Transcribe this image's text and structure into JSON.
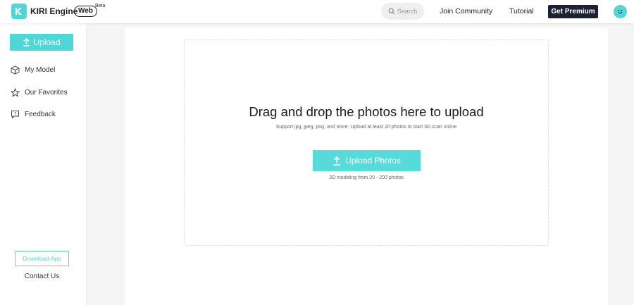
{
  "header": {
    "brand": "KIRI Engine",
    "web_badge": "Web",
    "beta_label": "Beta",
    "search_label": "Search",
    "nav": {
      "community": "Join Community",
      "tutorial": "Tutorial"
    },
    "premium_label": "Get Premium"
  },
  "sidebar": {
    "upload_label": "Upload",
    "items": [
      {
        "label": "My Model",
        "icon": "cube-icon"
      },
      {
        "label": "Our Favorites",
        "icon": "star-icon"
      },
      {
        "label": "Feedback",
        "icon": "feedback-icon"
      }
    ],
    "download_label": "Download App",
    "contact_label": "Contact Us"
  },
  "main": {
    "drop_title": "Drag and drop the photos here to upload",
    "drop_subtitle": "Support jpg, jpeg, png, and more. Upload at least 20 photos to start 3D scan online",
    "upload_button": "Upload Photos",
    "photo_range": "3D modeling from 20 - 200 photos"
  },
  "colors": {
    "accent": "#4fd6d6",
    "premium_bg": "#1a2233"
  }
}
